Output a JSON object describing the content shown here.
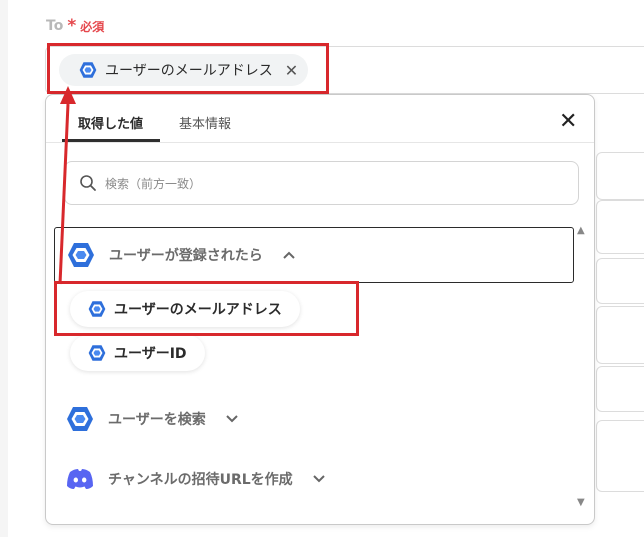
{
  "field": {
    "label": "To",
    "required_star": "*",
    "required_text": "必須"
  },
  "selected_chip": {
    "label": "ユーザーのメールアドレス",
    "close_glyph": "✕"
  },
  "popup": {
    "tabs": [
      {
        "label": "取得した値",
        "active": true
      },
      {
        "label": "基本情報",
        "active": false
      }
    ],
    "close_glyph": "✕",
    "search": {
      "placeholder": "検索（前方一致）"
    },
    "sections": [
      {
        "label": "ユーザーが登録されたら",
        "expanded": true,
        "icon": "gcp-hexagon-icon"
      },
      {
        "label": "ユーザーを検索",
        "expanded": false,
        "icon": "gcp-hexagon-icon"
      },
      {
        "label": "チャンネルの招待URLを作成",
        "expanded": false,
        "icon": "discord-icon"
      }
    ],
    "results": [
      {
        "label": "ユーザーのメールアドレス"
      },
      {
        "label": "ユーザーID"
      }
    ]
  },
  "colors": {
    "highlight": "#d8282c",
    "required": "#e5484d",
    "gcp_blue": "#2e6fdb",
    "discord": "#5865f2"
  }
}
